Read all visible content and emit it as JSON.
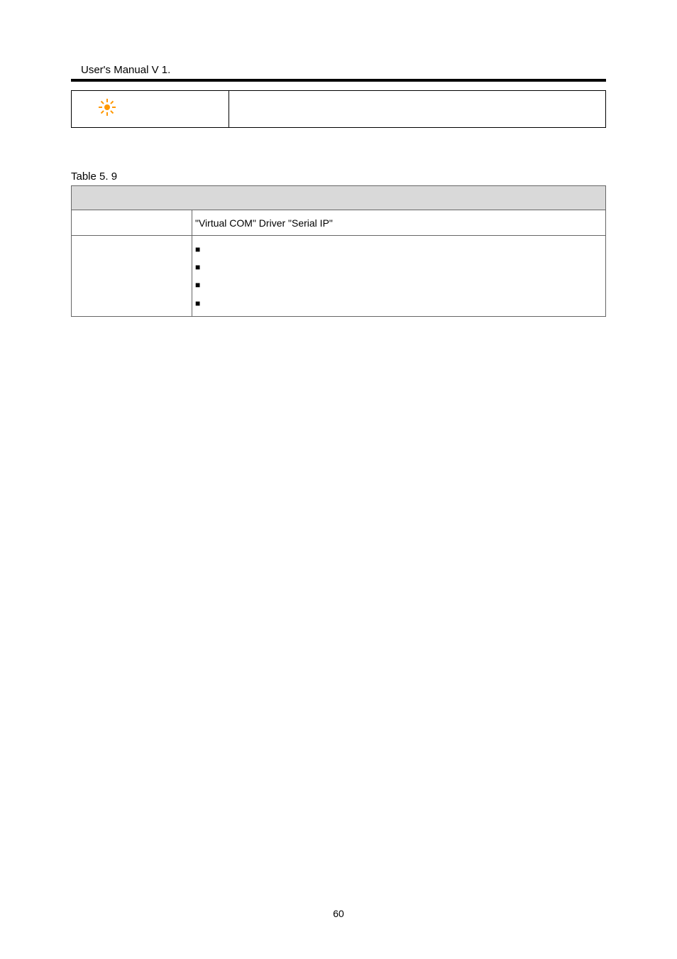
{
  "header": {
    "title": "User's Manual V 1."
  },
  "table1": {
    "icon_alt": "sun-icon"
  },
  "caption": "Table 5. 9",
  "table2": {
    "desc_left": "",
    "desc_right": "\"Virtual COM\" Driver \"Serial IP\"",
    "proc_left": "",
    "bullets": [
      "",
      "",
      "",
      ""
    ]
  },
  "footer": {
    "page": "60"
  }
}
